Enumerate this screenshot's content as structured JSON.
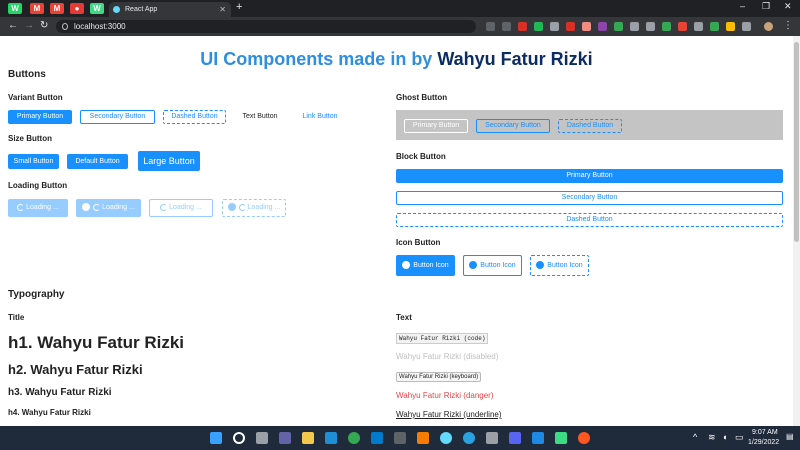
{
  "browser": {
    "active_tab": "React App",
    "new_tab": "+",
    "url": "localhost:3000",
    "pinned_tabs": [
      {
        "glyph": "W",
        "color": "#25d366"
      },
      {
        "glyph": "M",
        "color": "#ea4335"
      },
      {
        "glyph": "M",
        "color": "#ea4335"
      },
      {
        "glyph": "●",
        "color": "#e53935"
      },
      {
        "glyph": "W",
        "color": "#3ddc84"
      }
    ]
  },
  "page": {
    "title_prefix": "UI Components made in by ",
    "title_name": "Wahyu Fatur Rizki"
  },
  "buttons": {
    "heading": "Buttons",
    "variant_heading": "Variant Button",
    "primary": "Primary Button",
    "secondary": "Secondary Button",
    "dashed": "Dashed Button",
    "text": "Text Button",
    "link": "Link Button",
    "size_heading": "Size Button",
    "small": "Small Button",
    "default": "Default Button",
    "large": "Large Button",
    "loading_heading": "Loading Button",
    "loading": "Loading ...",
    "ghost_heading": "Ghost Button",
    "block_heading": "Block Button",
    "icon_heading": "Icon Button",
    "icon": "Button Icon"
  },
  "typography": {
    "heading": "Typography",
    "title_heading": "Title",
    "h1": "h1. Wahyu Fatur Rizki",
    "h2": "h2. Wahyu Fatur Rizki",
    "h3": "h3. Wahyu Fatur Rizki",
    "h4": "h4. Wahyu Fatur Rizki",
    "text_heading": "Text",
    "code": "Wahyu Fatur Rizki (code)",
    "disabled": "Wahyu Fatur Rizki (disabled)",
    "keyboard": "Wahyu Fatur Rizki (keyboard)",
    "danger": "Wahyu Fatur Rizki (danger)",
    "underline": "Wahyu Fatur Rizki (underline)"
  },
  "taskbar": {
    "time": "9:07 AM",
    "date": "1/29/2022"
  },
  "colors": {
    "primary": "#1890ff",
    "title_blue": "#2e8ee0",
    "title_navy": "#0d2c64",
    "danger": "#e04848"
  }
}
